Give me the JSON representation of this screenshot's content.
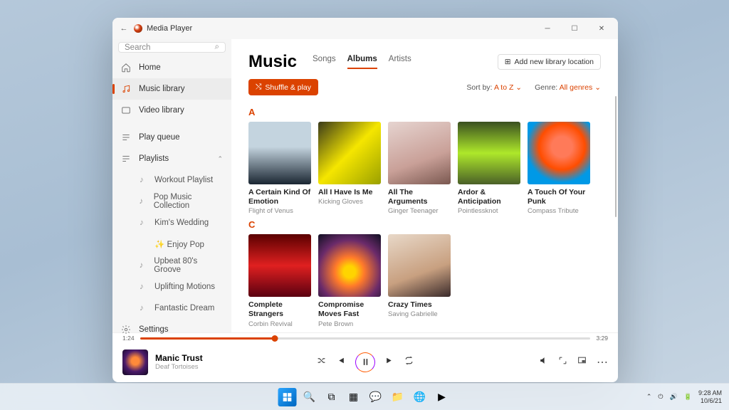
{
  "app": {
    "title": "Media Player"
  },
  "search": {
    "placeholder": "Search"
  },
  "sidebar": {
    "home": "Home",
    "music": "Music library",
    "video": "Video library",
    "queue": "Play queue",
    "playlists_header": "Playlists",
    "playlists": [
      {
        "name": "Workout Playlist"
      },
      {
        "name": "Pop Music Collection"
      },
      {
        "name": "Kim's Wedding"
      },
      {
        "name": "✨ Enjoy Pop"
      },
      {
        "name": "Upbeat 80's Groove"
      },
      {
        "name": "Uplifting Motions"
      },
      {
        "name": "Fantastic Dream"
      }
    ],
    "settings": "Settings"
  },
  "header": {
    "title": "Music",
    "tabs": {
      "songs": "Songs",
      "albums": "Albums",
      "artists": "Artists"
    },
    "add_library": "Add new library location"
  },
  "toolbar": {
    "shuffle": "Shuffle & play",
    "sortby_label": "Sort by:",
    "sortby_value": "A to Z",
    "genre_label": "Genre:",
    "genre_value": "All genres"
  },
  "sections": [
    {
      "letter": "A",
      "albums": [
        {
          "title": "A Certain Kind Of Emotion",
          "artist": "Flight of Venus"
        },
        {
          "title": "All I Have Is Me",
          "artist": "Kicking Gloves"
        },
        {
          "title": "All The Arguments",
          "artist": "Ginger Teenager"
        },
        {
          "title": "Ardor & Anticipation",
          "artist": "Pointlessknot"
        },
        {
          "title": "A Touch Of Your Punk",
          "artist": "Compass Tribute"
        }
      ]
    },
    {
      "letter": "C",
      "albums": [
        {
          "title": "Complete Strangers",
          "artist": "Corbin Revival"
        },
        {
          "title": "Compromise Moves Fast",
          "artist": "Pete Brown"
        },
        {
          "title": "Crazy Times",
          "artist": "Saving Gabrielle"
        }
      ]
    },
    {
      "letter": "C",
      "albums": []
    }
  ],
  "player": {
    "elapsed": "1:24",
    "total": "3:29",
    "song": "Manic Trust",
    "artist": "Deaf Tortoises"
  },
  "system": {
    "time": "9:28 AM",
    "date": "10/6/21"
  }
}
